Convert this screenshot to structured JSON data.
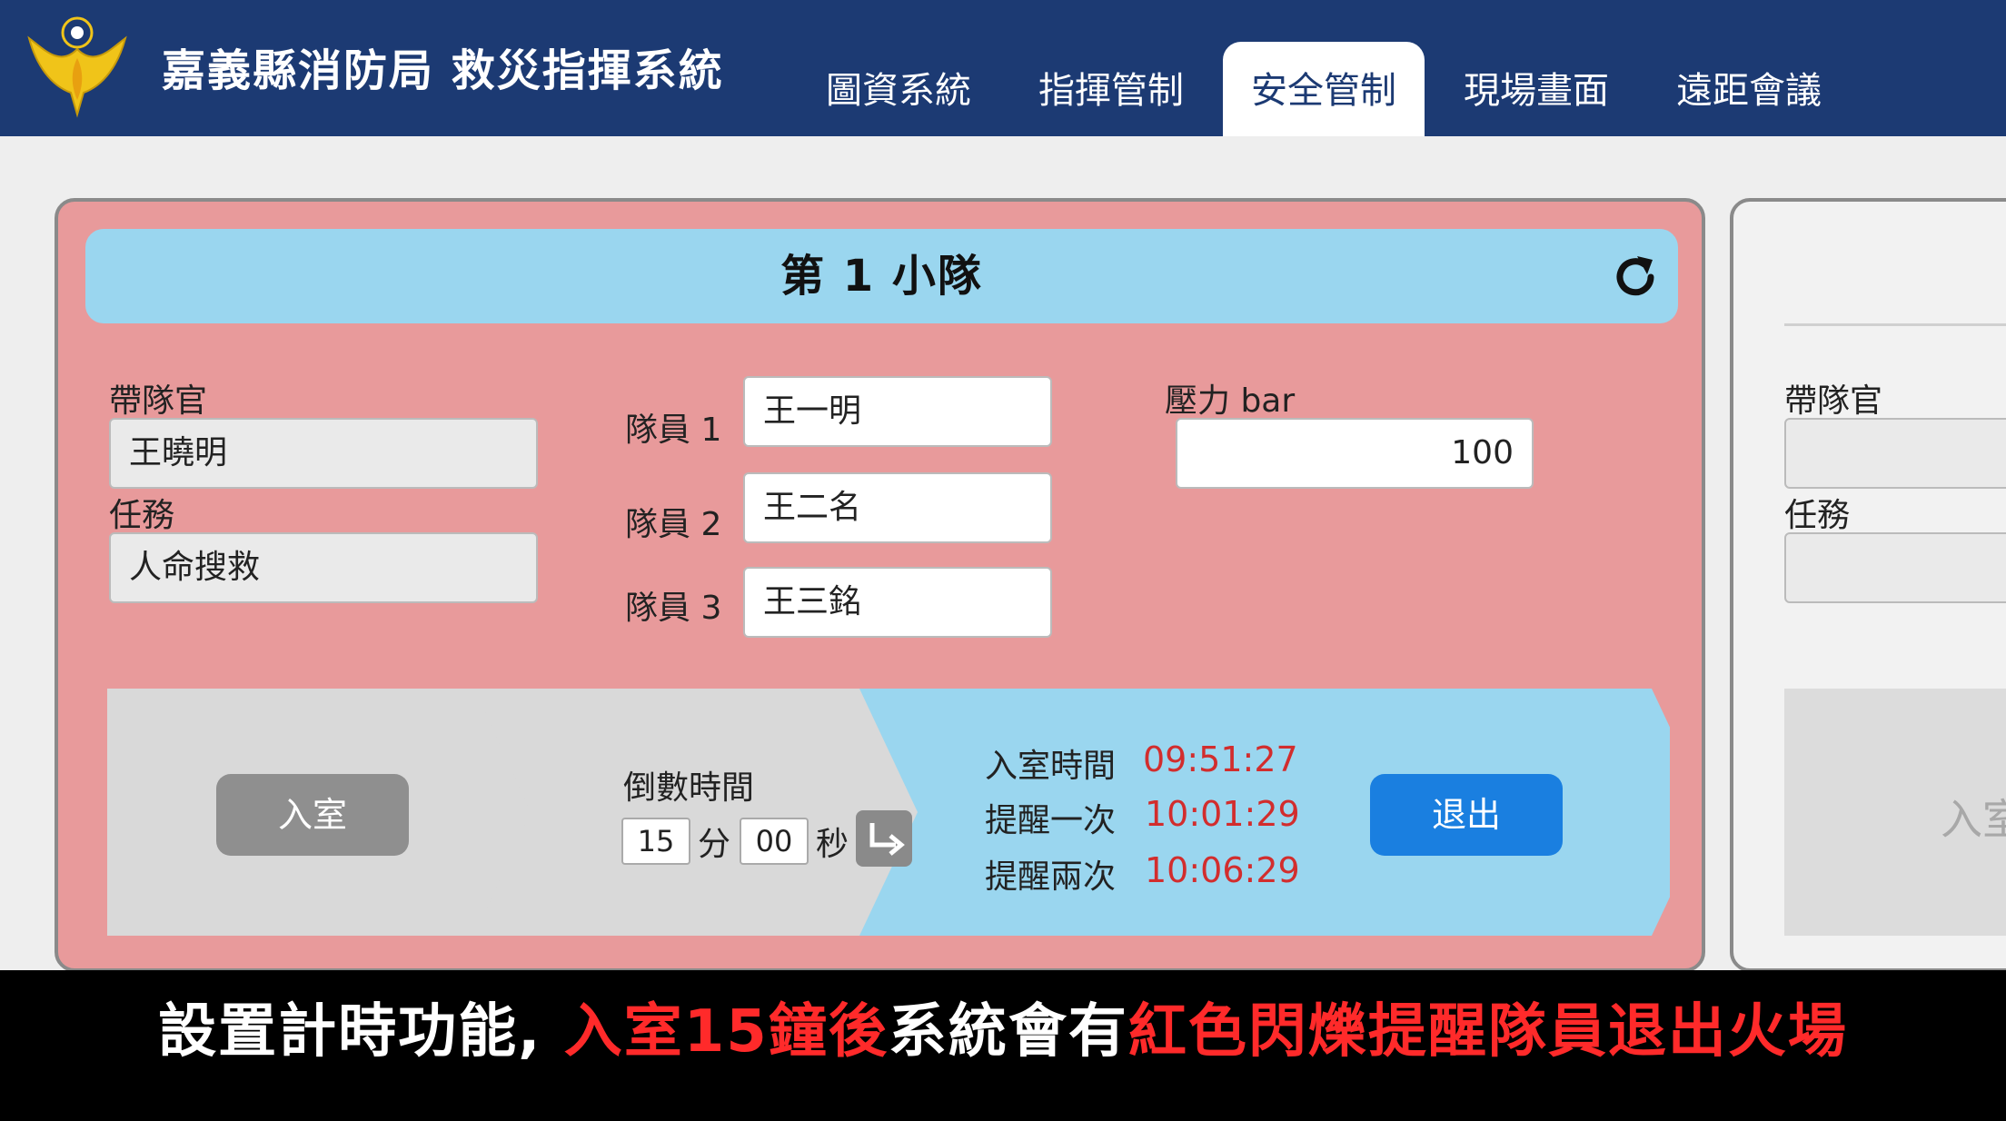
{
  "header": {
    "title": "嘉義縣消防局 救災指揮系統",
    "tabs": [
      {
        "label": "圖資系統"
      },
      {
        "label": "指揮管制"
      },
      {
        "label": "安全管制",
        "active": true
      },
      {
        "label": "現場畫面"
      },
      {
        "label": "遠距會議"
      }
    ]
  },
  "squad": {
    "title": "第 1 小隊",
    "leader_label": "帶隊官",
    "leader_value": "王曉明",
    "task_label": "任務",
    "task_value": "人命搜救",
    "members": [
      {
        "label": "隊員 1",
        "value": "王一明"
      },
      {
        "label": "隊員 2",
        "value": "王二名"
      },
      {
        "label": "隊員 3",
        "value": "王三銘"
      }
    ],
    "pressure_label": "壓力 bar",
    "pressure_value": "100",
    "enter_button": "入室",
    "countdown_label": "倒數時間",
    "countdown_minutes": "15",
    "minute_unit": "分",
    "countdown_seconds": "00",
    "second_unit": "秒",
    "entry_time_label": "入室時間",
    "entry_time": "09:51:27",
    "reminder1_label": "提醒一次",
    "reminder1_time": "10:01:29",
    "reminder2_label": "提醒兩次",
    "reminder2_time": "10:06:29",
    "exit_button": "退出"
  },
  "squad2": {
    "leader_label": "帶隊官",
    "task_label": "任務",
    "enter_button_partial": "入室"
  },
  "subtitle": {
    "part1": "設置計時功能, ",
    "part2": "入室15鐘後",
    "part3": "系統會有",
    "part4": "紅色閃爍提醒隊員退出火場"
  },
  "colors": {
    "header_bg": "#1c3a73",
    "panel_bg": "#e89a9b",
    "panel_header_bg": "#9ad6ef",
    "exit_button": "#1a7fe0",
    "enter_button": "#8f8f8f",
    "alert_red": "#d22d2d"
  }
}
